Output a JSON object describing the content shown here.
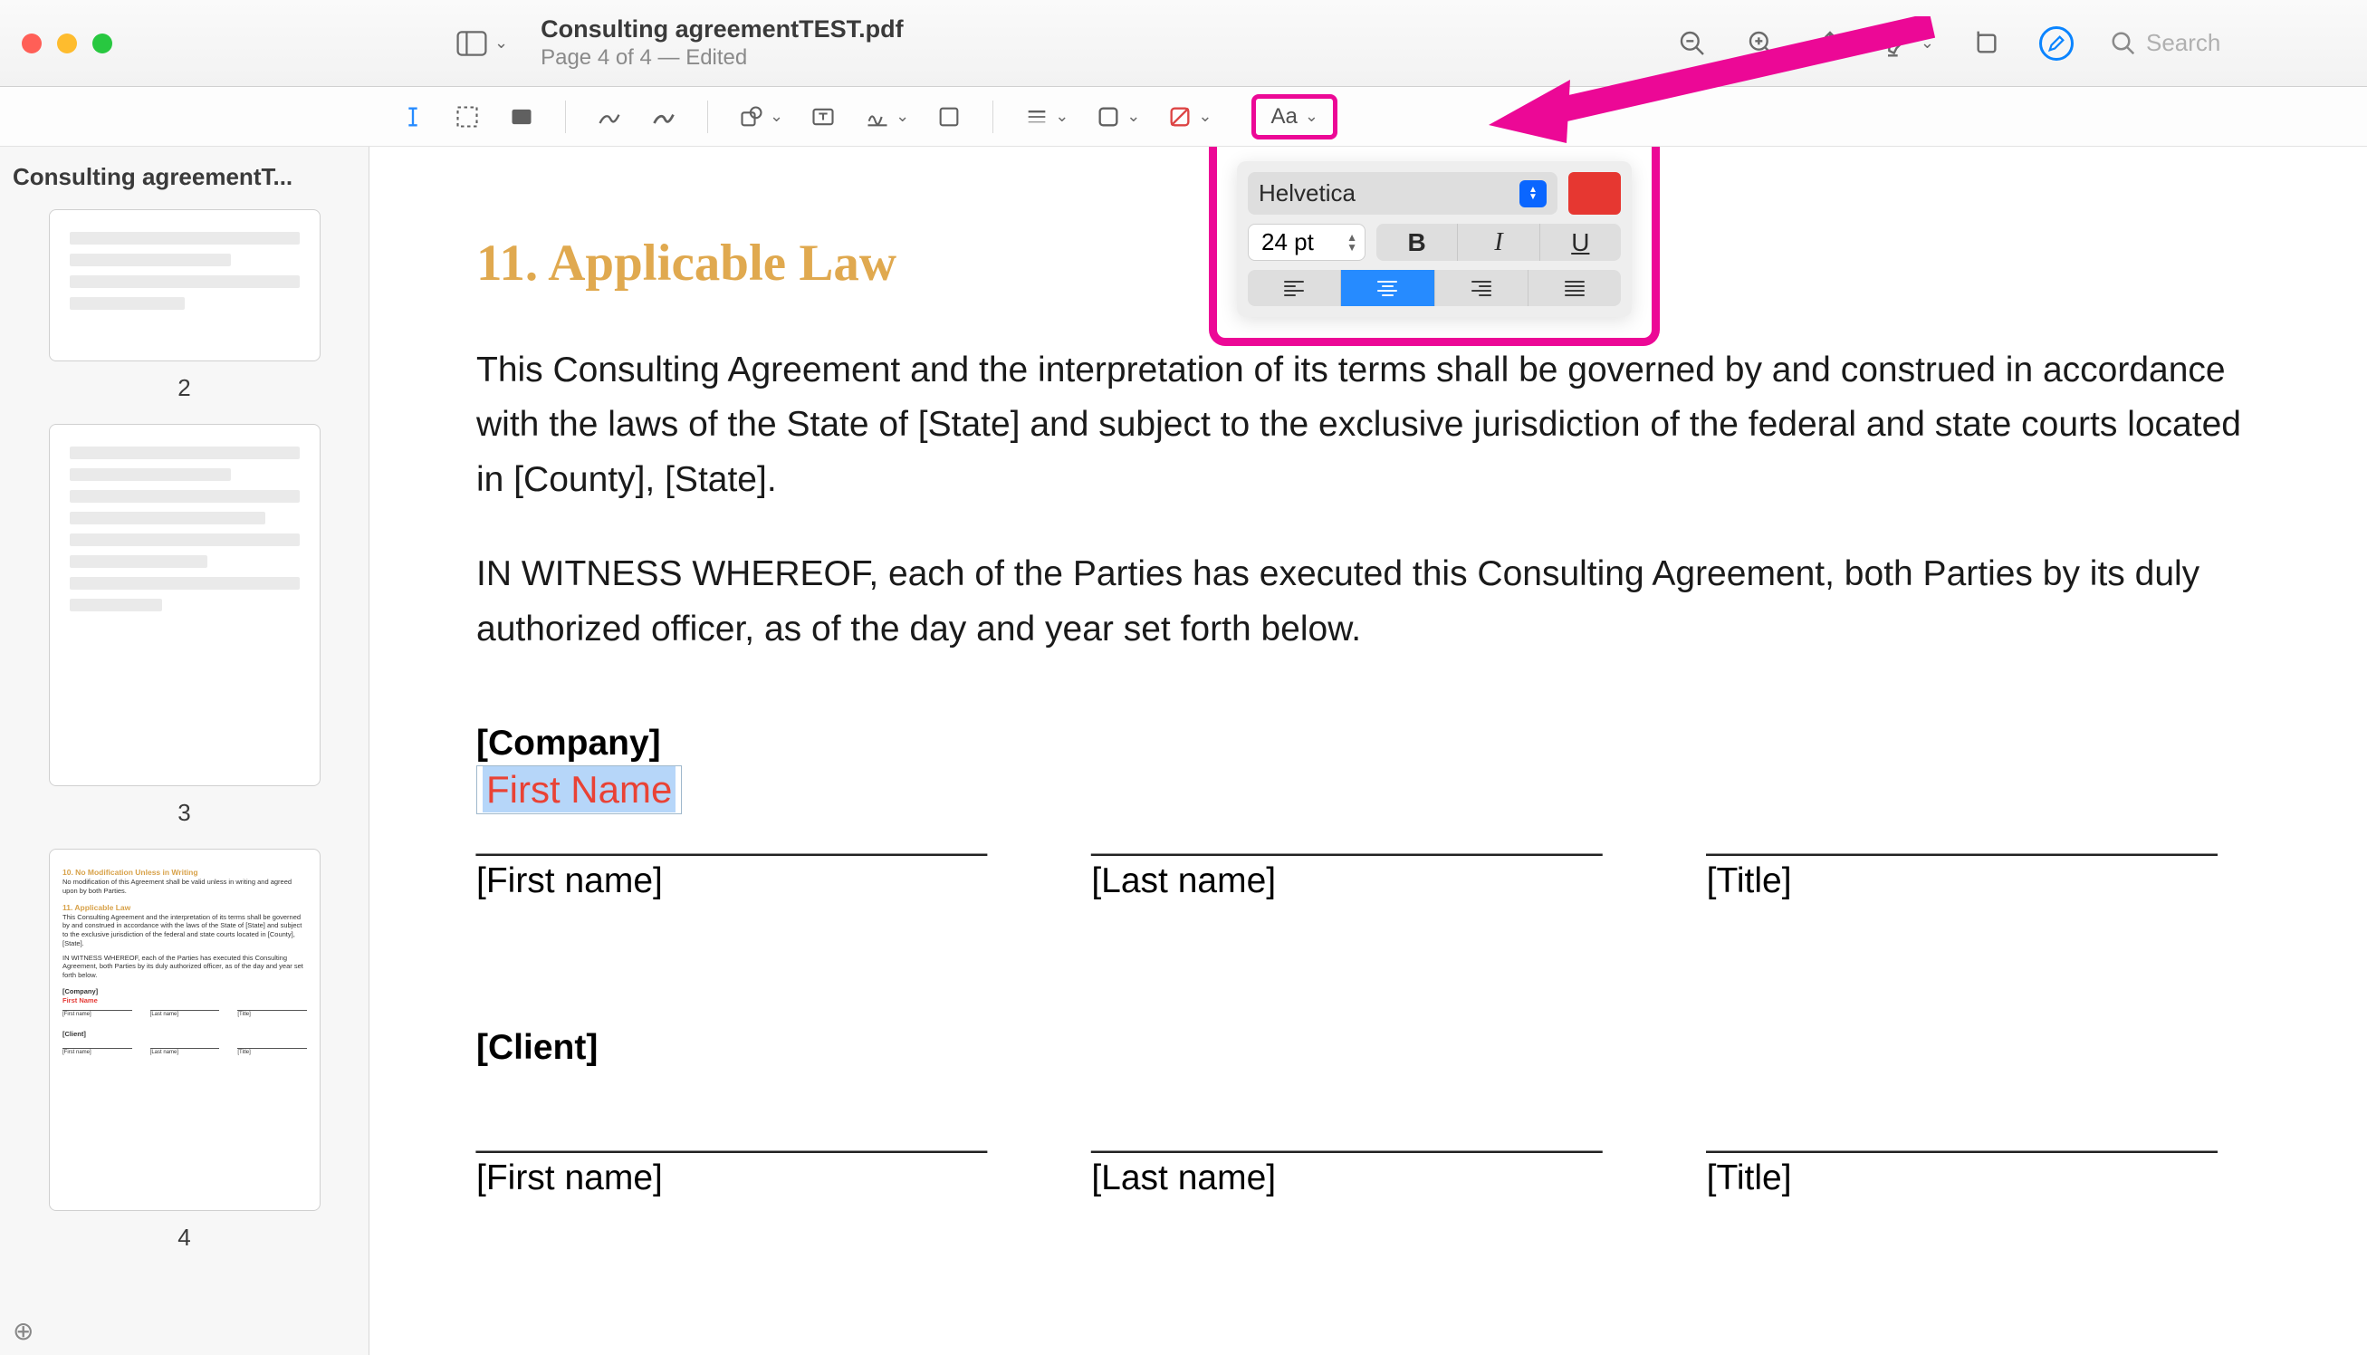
{
  "titlebar": {
    "doc_title": "Consulting agreementTEST.pdf",
    "doc_subtitle": "Page 4 of 4 — Edited",
    "search_placeholder": "Search"
  },
  "markup_toolbar": {
    "aa_label": "Aa"
  },
  "text_style": {
    "font": "Helvetica",
    "size": "24 pt",
    "bold": "B",
    "italic": "I",
    "underline": "U",
    "color": "#e63731",
    "alignment": "center"
  },
  "sidebar": {
    "title": "Consulting agreementT...",
    "pages": [
      "2",
      "3",
      "4"
    ]
  },
  "thumb4": {
    "h1": "10. No Modification Unless in Writing",
    "p1": "No modification of this Agreement shall be valid unless in writing and agreed upon by both Parties.",
    "h2": "11. Applicable Law",
    "p2": "This Consulting Agreement and the interpretation of its terms shall be governed by and construed in accordance with the laws of the State of [State] and subject to the exclusive jurisdiction of the federal and state courts located in [County], [State].",
    "p3": "IN WITNESS WHEREOF, each of the Parties has executed this Consulting Agreement, both Parties by its duly authorized officer, as of the day and year set forth below.",
    "company": "[Company]",
    "first_name": "First Name",
    "client": "[Client]",
    "fn": "[First name]",
    "ln": "[Last name]",
    "tt": "[Title]"
  },
  "doc": {
    "heading": "11. Applicable Law",
    "para1": "This Consulting Agreement and the interpretation of its terms shall be governed by and construed in accordance with the laws of the State of [State] and subject to the exclusive jurisdiction of the federal and state courts located in [County], [State].",
    "para2": "IN WITNESS WHEREOF, each of the Parties has executed this Consulting Agreement, both Parties by its duly authorized officer, as of the day and year set forth below.",
    "company_label": "[Company]",
    "client_label": "[Client]",
    "first_name_annotation": "First Name",
    "signature_line": "__________________________",
    "first_name": "[First name]",
    "last_name": "[Last name]",
    "title_field": "[Title]"
  }
}
